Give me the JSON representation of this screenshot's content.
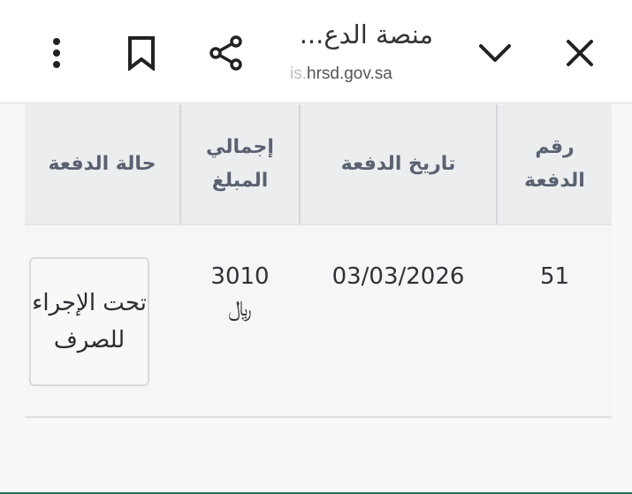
{
  "browser": {
    "title": "منصة الدع...",
    "url_prefix": "is.",
    "url_main": "hrsd.gov.sa",
    "icons": {
      "close": "close-icon",
      "collapse": "chevron-down-icon",
      "share": "share-icon",
      "bookmark": "bookmark-icon",
      "menu": "more-vertical-icon"
    }
  },
  "table": {
    "headers": {
      "payment_number": "رقم الدفعة",
      "payment_date": "تاريخ الدفعة",
      "total_amount": "إجمالي المبلغ",
      "payment_status": "حالة الدفعة"
    },
    "rows": [
      {
        "payment_number": "51",
        "payment_date": "03/03/2026",
        "total_amount": "3010",
        "currency_symbol": "﷼",
        "payment_status": "تحت الإجراء للصرف"
      }
    ]
  },
  "colors": {
    "header_bg": "#ebedef",
    "header_text": "#5a6170",
    "row_bg": "#f6f6f7",
    "accent_bottom": "#2e6b55"
  }
}
